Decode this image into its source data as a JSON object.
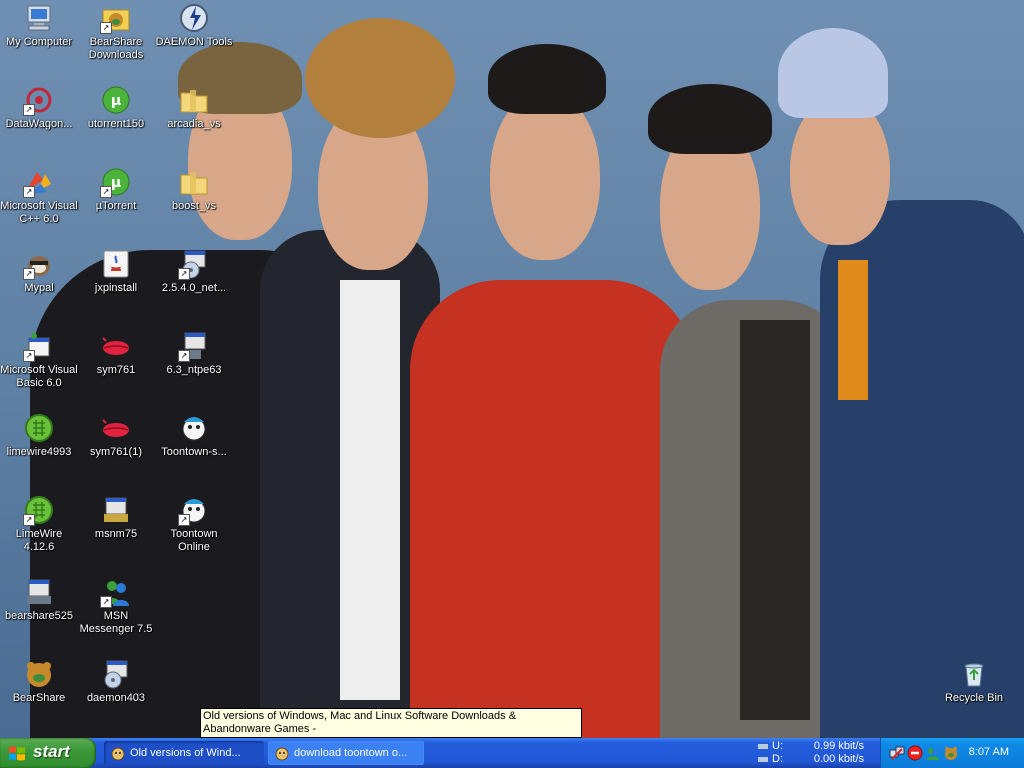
{
  "desktop": {
    "icons": [
      {
        "label": "My Computer",
        "icon": "my-computer-icon"
      },
      {
        "label": "BearShare\nDownloads",
        "icon": "bearshare-downloads-icon"
      },
      {
        "label": "DAEMON Tools",
        "icon": "daemon-tools-icon"
      },
      {
        "label": "DataWagon...",
        "icon": "datawagon-icon"
      },
      {
        "label": "utorrent150",
        "icon": "utorrent-icon"
      },
      {
        "label": "arcadia_vs",
        "icon": "folder-icon"
      },
      {
        "label": "Microsoft Visual\nC++ 6.0",
        "icon": "visual-cpp-icon"
      },
      {
        "label": "µTorrent",
        "icon": "utorrent-icon"
      },
      {
        "label": "boost_vs",
        "icon": "folder-icon"
      },
      {
        "label": "Mypal",
        "icon": "mypal-icon"
      },
      {
        "label": "jxpinstall",
        "icon": "java-icon"
      },
      {
        "label": "2.5.4.0_net...",
        "icon": "installer-icon"
      },
      {
        "label": "Microsoft Visual\nBasic 6.0",
        "icon": "visual-basic-icon"
      },
      {
        "label": "sym761",
        "icon": "lips-icon"
      },
      {
        "label": "6.3_ntpe63",
        "icon": "installer-icon"
      },
      {
        "label": "limewire4993",
        "icon": "limewire-icon"
      },
      {
        "label": "sym761(1)",
        "icon": "lips-icon"
      },
      {
        "label": "Toontown-s...",
        "icon": "toontown-icon"
      },
      {
        "label": "LimeWire\n4.12.6",
        "icon": "limewire-icon"
      },
      {
        "label": "msnm75",
        "icon": "setup-icon"
      },
      {
        "label": "Toontown\nOnline",
        "icon": "toontown-icon"
      },
      {
        "label": "bearshare525",
        "icon": "setup-icon"
      },
      {
        "label": "MSN\nMessenger 7.5",
        "icon": "msn-messenger-icon"
      },
      {
        "label": "BearShare",
        "icon": "bearshare-icon"
      },
      {
        "label": "daemon403",
        "icon": "installer-icon"
      },
      {
        "label": "Recycle Bin",
        "icon": "recycle-bin-icon"
      }
    ]
  },
  "tooltip": {
    "text": "Old versions of Windows, Mac and Linux Software Downloads & Abandonware Games -"
  },
  "taskbar": {
    "start_label": "start",
    "tasks": [
      {
        "label": "Old versions of Wind...",
        "icon": "browser-icon",
        "active": true
      },
      {
        "label": "download toontown o...",
        "icon": "browser-icon",
        "active": false
      }
    ],
    "network": {
      "upload_label": "U:",
      "upload_value": "0.99 kbit/s",
      "download_label": "D:",
      "download_value": "0.00 kbit/s"
    },
    "tray_icons": [
      "network-icon",
      "antivirus-icon",
      "messenger-icon",
      "bearshare-tray-icon"
    ],
    "clock": "8:07 AM"
  },
  "colors": {
    "taskbar": "#245edb",
    "start": "#3c9a3a",
    "tray": "#0e8ae6",
    "tooltip": "#ffffe1"
  }
}
